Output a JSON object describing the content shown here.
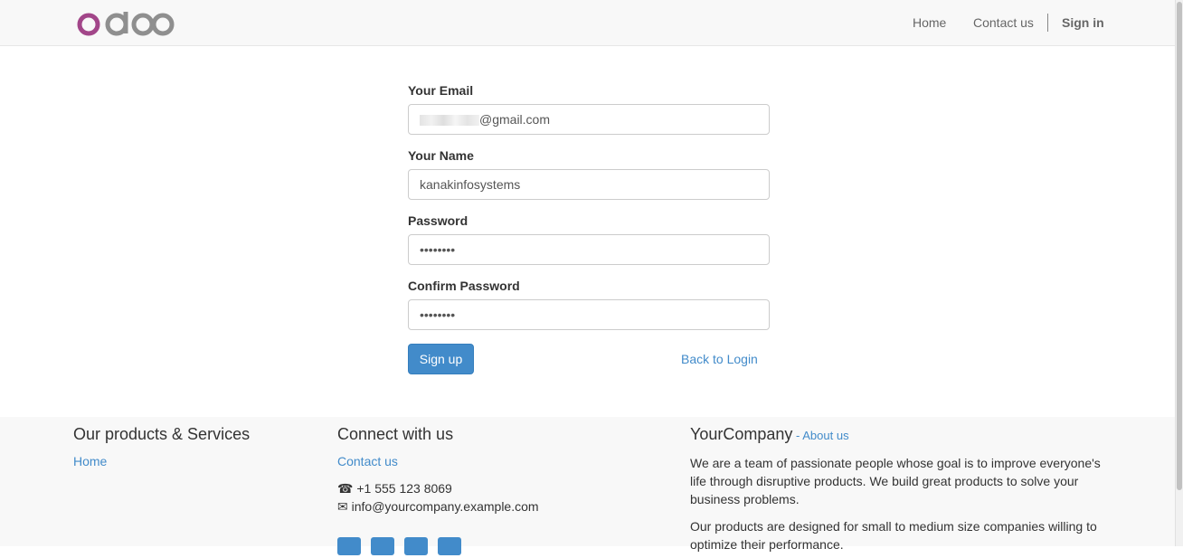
{
  "header": {
    "logo_text": "odoo",
    "nav": [
      "Home",
      "Contact us"
    ],
    "signin": "Sign in"
  },
  "form": {
    "email_label": "Your Email",
    "email_value_visible": "@gmail.com",
    "name_label": "Your Name",
    "name_value": "kanakinfosystems",
    "password_label": "Password",
    "password_value": "••••••••",
    "confirm_label": "Confirm Password",
    "confirm_value": "••••••••",
    "signup_button": "Sign up",
    "back_to_login": "Back to Login"
  },
  "footer": {
    "products_title": "Our products & Services",
    "products_home": "Home",
    "connect_title": "Connect with us",
    "contact_link": "Contact us",
    "phone": "+1 555 123 8069",
    "email": "info@yourcompany.example.com",
    "company_title": "YourCompany",
    "about_sep": " - ",
    "about_link": "About us",
    "para1": "We are a team of passionate people whose goal is to improve everyone's life through disruptive products. We build great products to solve your business problems.",
    "para2": "Our products are designed for small to medium size companies willing to optimize their performance."
  },
  "colors": {
    "brand_purple": "#a24689",
    "logo_gray": "#8f8f8f",
    "link_blue": "#428bca",
    "primary_button": "#428bca"
  }
}
